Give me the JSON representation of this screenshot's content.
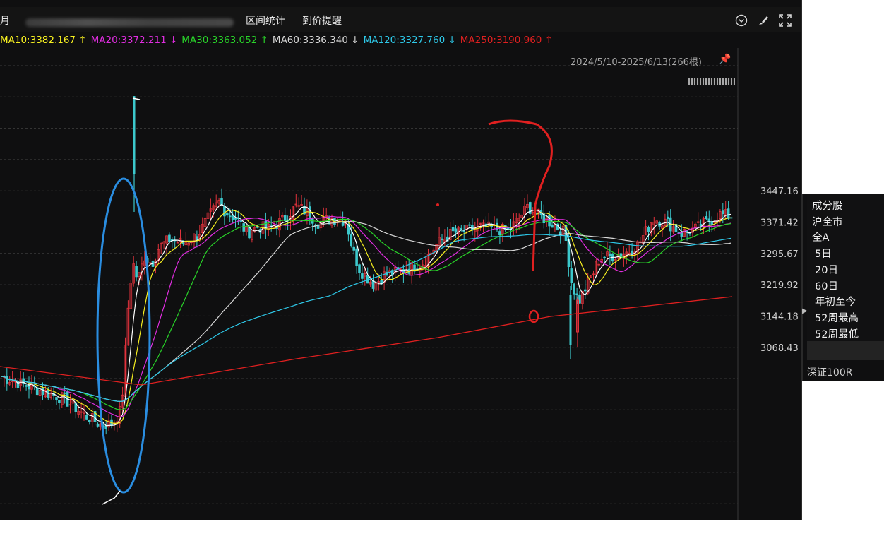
{
  "top": {
    "left_label": "月",
    "tabs": [
      "区间统计",
      "到价提醒"
    ],
    "icons": [
      "chevron-down-circle-icon",
      "brush-icon",
      "fullscreen-icon"
    ]
  },
  "ma_legend": [
    {
      "text": "MA10:3382.167 ↑",
      "color": "#f7f020"
    },
    {
      "text": "MA20:3372.211 ↓",
      "color": "#e02de0"
    },
    {
      "text": "MA30:3363.052 ↑",
      "color": "#29d329"
    },
    {
      "text": "MA60:3336.340 ↓",
      "color": "#d8d8d8"
    },
    {
      "text": "MA120:3327.760 ↓",
      "color": "#2ec8e8"
    },
    {
      "text": "MA250:3190.960 ↑",
      "color": "#e02020"
    }
  ],
  "range_label": "2024/5/10-2025/6/13(266根)",
  "side_panel": {
    "items": [
      "成分股",
      "沪全市",
      "全A",
      "5日",
      "20日",
      "60日",
      "年初至今",
      "52周最高",
      "52周最低"
    ],
    "bottom": "深证100R"
  },
  "chart_data": {
    "type": "candlestick",
    "y_ticks": [
      3447.16,
      3371.42,
      3295.67,
      3219.92,
      3144.18,
      3068.43
    ],
    "x_range": "2024/5/10-2025/6/13",
    "bars": 266,
    "ma_last": {
      "MA10": 3382.167,
      "MA20": 3372.211,
      "MA30": 3363.052,
      "MA60": 3336.34,
      "MA120": 3327.76,
      "MA250": 3190.96
    },
    "annotations": [
      "blue-ellipse",
      "red-question-mark",
      "red-small-circle",
      "red-dot"
    ],
    "colors": {
      "up": "#e0323c",
      "down": "#3cc8cc",
      "grid": "#3a3a3a"
    }
  }
}
